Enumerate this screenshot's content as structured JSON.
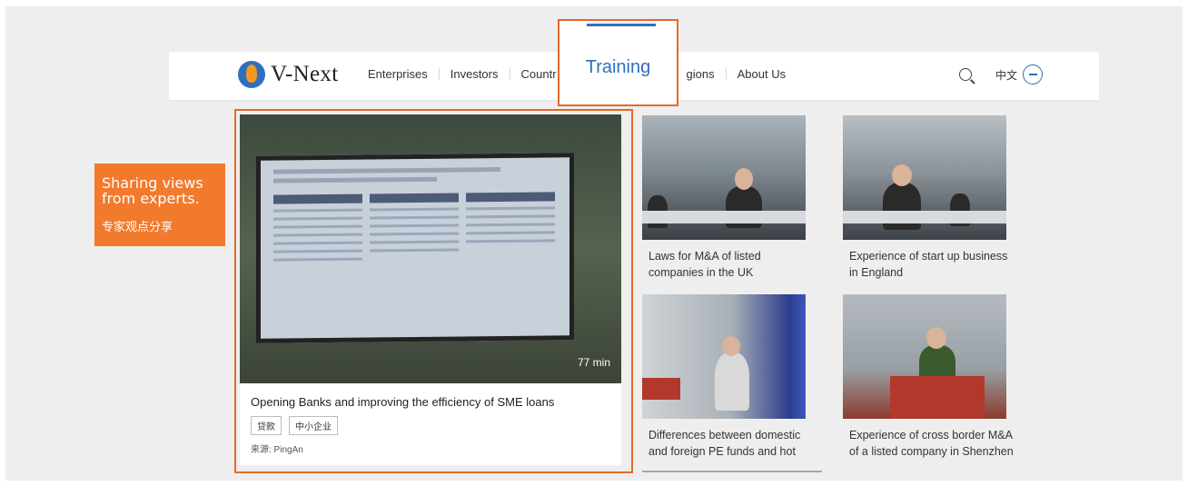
{
  "brand": {
    "name": "V-Next",
    "accent": "#2f6fc0",
    "highlight": "#e8672a",
    "badge_color": "#f27a2d"
  },
  "nav": {
    "items": [
      "Enterprises",
      "Investors",
      "Countr",
      "gions",
      "About Us"
    ],
    "training_label": "Training",
    "language": "中文",
    "icons": {
      "search": "search-icon",
      "language_toggle": "minus-circle-icon"
    }
  },
  "badge": {
    "en": "Sharing views from experts.",
    "zh": "专家观点分享"
  },
  "featured": {
    "duration": "77 min",
    "title": "Opening Banks and improving the efficiency of SME loans",
    "tags": [
      "贷款",
      "中小企业"
    ],
    "source": "来源: PingAn"
  },
  "cards": [
    {
      "caption_1": "Laws for M&A of listed",
      "caption_2": "companies in the UK"
    },
    {
      "caption_1": "Experience of start up business",
      "caption_2": "in England"
    },
    {
      "caption_1": "Differences between domestic",
      "caption_2": "and foreign PE funds and hot"
    },
    {
      "caption_1": "Experience of cross border M&A",
      "caption_2": "of a listed company in Shenzhen"
    }
  ]
}
